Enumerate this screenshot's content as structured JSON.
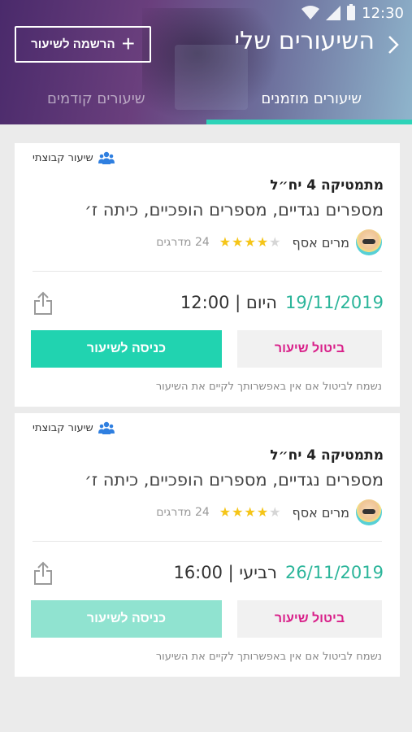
{
  "status_bar": {
    "time": "12:30"
  },
  "header": {
    "title": "השיעורים שלי",
    "register_label": "הרשמה לשיעור"
  },
  "tabs": [
    {
      "label": "שיעורים מוזמנים",
      "active": true
    },
    {
      "label": "שיעורים קודמים",
      "active": false
    }
  ],
  "lessons": [
    {
      "type_label": "שיעור קבוצתי",
      "subject": "מתמטיקה 4 יח״ל",
      "title": "מספרים נגדיים, מספרים הופכיים, כיתה ז׳",
      "tutor": "מרים אסף",
      "rating": 4,
      "rating_max": 5,
      "reviews": "24 מדרגים",
      "date": "19/11/2019",
      "day_time": "היום | 12:00",
      "cancel_label": "ביטול שיעור",
      "enter_label": "כניסה לשיעור",
      "enter_enabled": true,
      "note": "נשמח לביטול אם אין באפשרותך לקיים את השיעור"
    },
    {
      "type_label": "שיעור קבוצתי",
      "subject": "מתמטיקה 4 יח״ל",
      "title": "מספרים נגדיים, מספרים הופכיים, כיתה ז׳",
      "tutor": "מרים אסף",
      "rating": 4,
      "rating_max": 5,
      "reviews": "24 מדרגים",
      "date": "26/11/2019",
      "day_time": "רביעי | 16:00",
      "cancel_label": "ביטול שיעור",
      "enter_label": "כניסה לשיעור",
      "enter_enabled": false,
      "note": "נשמח לביטול אם אין באפשרותך לקיים את השיעור"
    }
  ],
  "colors": {
    "accent": "#21d3b0",
    "date": "#2bb59a",
    "cancel": "#d9218a",
    "star": "#f5c518",
    "tab_indicator": "#2dd3b8"
  }
}
